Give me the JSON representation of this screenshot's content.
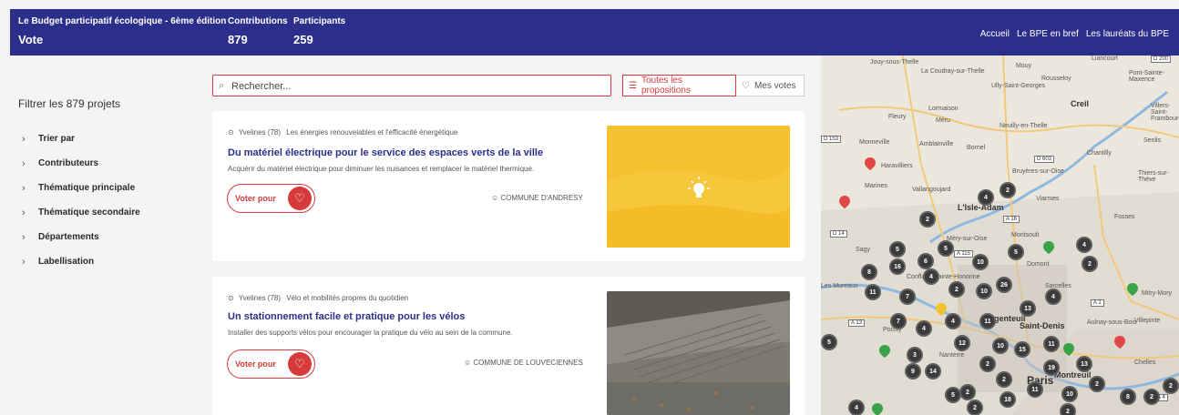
{
  "header": {
    "title_small": "Le Budget participatif écologique - 6ème édition",
    "title_big": "Vote",
    "stats": [
      {
        "label": "Contributions",
        "value": "879"
      },
      {
        "label": "Participants",
        "value": "259"
      }
    ],
    "nav": [
      "Accueil",
      "Le BPE en bref",
      "Les lauréats du BPE"
    ]
  },
  "sidebar": {
    "filter_title": "Filtrer les 879 projets",
    "items": [
      {
        "label": "Trier par"
      },
      {
        "label": "Contributeurs"
      },
      {
        "label": "Thématique principale"
      },
      {
        "label": "Thématique secondaire"
      },
      {
        "label": "Départements"
      },
      {
        "label": "Labellisation"
      }
    ]
  },
  "search": {
    "placeholder": "Rechercher..."
  },
  "toggles": {
    "all": "Toutes les propositions",
    "mine": "Mes votes"
  },
  "cards": [
    {
      "location": "Yvelines (78)",
      "theme": "Les énergies renouvelables et l'efficacité énergétique",
      "title": "Du matériel électrique pour le service des espaces verts de la ville",
      "description": "Acquérir du matériel électrique pour diminuer les nuisances et remplacer le matériel thermique.",
      "vote_label": "Voter pour",
      "author": "COMMUNE D'ANDRESY"
    },
    {
      "location": "Yvelines (78)",
      "theme": "Vélo et mobilités propres du quotidien",
      "title": "Un stationnement facile et pratique pour les vélos",
      "description": "Installer des supports vélos pour encourager la pratique du vélo au sein de la commune.",
      "vote_label": "Voter pour",
      "author": "COMMUNE DE LOUVECIENNES"
    }
  ],
  "map": {
    "places": [
      "Jouy-sous-Thelle",
      "La Coudray-sur-Thelle",
      "Mouy",
      "Rousseloy",
      "Pont-Sainte-Maxence",
      "Liancourt",
      "Ully-Saint-Georges",
      "Creil",
      "Villers-Saint-Frambourg",
      "Fleury",
      "Méru",
      "Neuilly-en-Thelle",
      "Senlis",
      "Monneville",
      "Amblainville",
      "Bornel",
      "Chantilly",
      "Haravilliers",
      "Bruyères-sur-Oise",
      "Thiers-sur-Thève",
      "Marines",
      "Vallangoujard",
      "Viarmes",
      "L'Isle-Adam",
      "Fosses",
      "Montsoult",
      "Méry-sur-Oise",
      "Sagy",
      "Domont",
      "Conflans-Sainte-Honorine",
      "Les Mureaux",
      "Sarcelles",
      "Mitry-Mory",
      "Argenteuil",
      "Saint-Denis",
      "Aulnay-sous-Bois",
      "Villepinte",
      "Paris",
      "Montreuil",
      "Chelles",
      "Nanterre",
      "Poissy",
      "Lormaison"
    ],
    "roads": [
      "D 200",
      "D 153",
      "D 603",
      "A 16",
      "D 14",
      "A 115",
      "A 1",
      "A 13",
      "A 4"
    ],
    "clusters": [
      "2",
      "4",
      "2",
      "4",
      "5",
      "6",
      "5",
      "16",
      "8",
      "10",
      "5",
      "4",
      "2",
      "11",
      "7",
      "2",
      "10",
      "26",
      "13",
      "4",
      "11",
      "7",
      "4",
      "4",
      "12",
      "10",
      "15",
      "11",
      "5",
      "3",
      "2",
      "13",
      "9",
      "14",
      "19",
      "2",
      "2",
      "10",
      "11",
      "2",
      "8",
      "2",
      "5",
      "2",
      "18",
      "4",
      "2",
      "2"
    ]
  },
  "colors": {
    "header_bg": "#2b2e8a",
    "accent": "#d63a3a",
    "card1_thumb": "#f5c12e"
  }
}
